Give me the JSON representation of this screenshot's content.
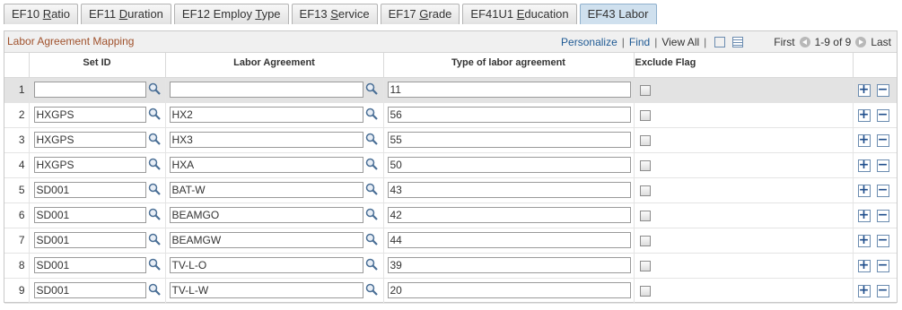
{
  "tabs": [
    {
      "pre": "EF10 ",
      "u": "R",
      "post": "atio"
    },
    {
      "pre": "EF11 ",
      "u": "D",
      "post": "uration"
    },
    {
      "pre": "EF12 Employ ",
      "u": "T",
      "post": "ype"
    },
    {
      "pre": "EF13 ",
      "u": "S",
      "post": "ervice"
    },
    {
      "pre": "EF17 ",
      "u": "G",
      "post": "rade"
    },
    {
      "pre": "EF41U1 ",
      "u": "E",
      "post": "ducation"
    },
    {
      "pre": "EF43 Labor",
      "u": "",
      "post": ""
    }
  ],
  "active_tab_index": 6,
  "grid": {
    "title": "Labor Agreement Mapping",
    "personalize": "Personalize",
    "find": "Find",
    "view_all": "View All",
    "first": "First",
    "range": "1-9 of 9",
    "last": "Last"
  },
  "columns": {
    "setid": "Set ID",
    "agreement": "Labor Agreement",
    "type": "Type of labor agreement",
    "exclude": "Exclude Flag"
  },
  "rows": [
    {
      "num": "1",
      "setid": "",
      "agreement": "",
      "type": "11",
      "exclude": false
    },
    {
      "num": "2",
      "setid": "HXGPS",
      "agreement": "HX2",
      "type": "56",
      "exclude": false
    },
    {
      "num": "3",
      "setid": "HXGPS",
      "agreement": "HX3",
      "type": "55",
      "exclude": false
    },
    {
      "num": "4",
      "setid": "HXGPS",
      "agreement": "HXA",
      "type": "50",
      "exclude": false
    },
    {
      "num": "5",
      "setid": "SD001",
      "agreement": "BAT-W",
      "type": "43",
      "exclude": false
    },
    {
      "num": "6",
      "setid": "SD001",
      "agreement": "BEAMGO",
      "type": "42",
      "exclude": false
    },
    {
      "num": "7",
      "setid": "SD001",
      "agreement": "BEAMGW",
      "type": "44",
      "exclude": false
    },
    {
      "num": "8",
      "setid": "SD001",
      "agreement": "TV-L-O",
      "type": "39",
      "exclude": false
    },
    {
      "num": "9",
      "setid": "SD001",
      "agreement": "TV-L-W",
      "type": "20",
      "exclude": false
    }
  ]
}
